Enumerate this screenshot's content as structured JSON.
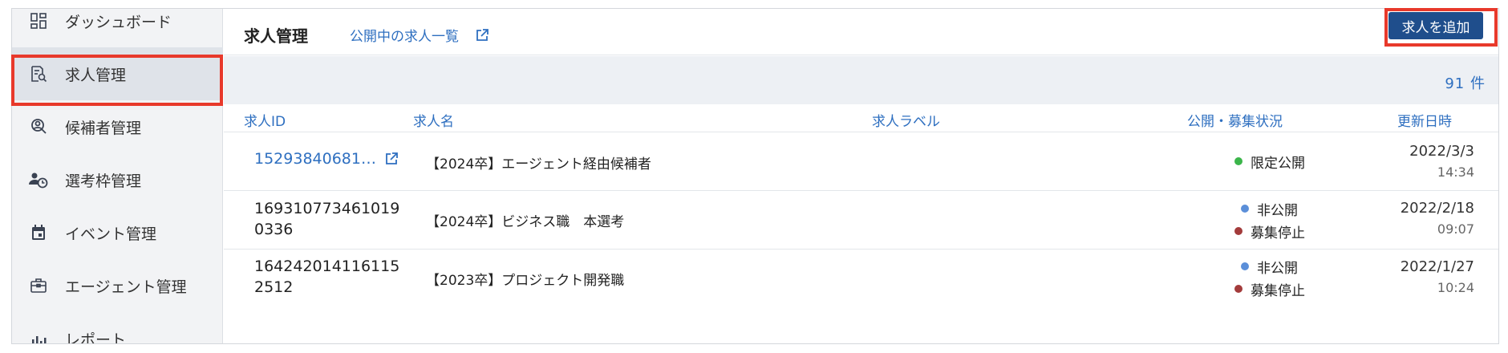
{
  "sidebar": {
    "items": [
      {
        "label": "ダッシュボード",
        "icon": "dashboard-icon"
      },
      {
        "label": "求人管理",
        "icon": "job-search-icon",
        "active": true
      },
      {
        "label": "候補者管理",
        "icon": "candidate-icon"
      },
      {
        "label": "選考枠管理",
        "icon": "schedule-user-icon"
      },
      {
        "label": "イベント管理",
        "icon": "calendar-icon"
      },
      {
        "label": "エージェント管理",
        "icon": "briefcase-icon"
      },
      {
        "label": "レポート",
        "icon": "report-chart-icon"
      }
    ]
  },
  "header": {
    "title": "求人管理",
    "public_link": "公開中の求人一覧",
    "add_button": "求人を追加"
  },
  "count_text": "91 件",
  "table": {
    "columns": [
      "求人ID",
      "求人名",
      "求人ラベル",
      "公開・募集状況",
      "更新日時"
    ],
    "rows": [
      {
        "id_line1": "15293840681…",
        "id_line2": "",
        "name": "【2024卒】エージェント経由候補者",
        "statuses": [
          {
            "text": "限定公開",
            "color": "#3bb54a"
          }
        ],
        "date": "2022/3/3",
        "time": "14:34"
      },
      {
        "id_line1": "169310773461019",
        "id_line2": "0336",
        "name": "【2024卒】ビジネス職　本選考",
        "statuses": [
          {
            "text": "非公開",
            "color": "#5b8fd9"
          },
          {
            "text": "募集停止",
            "color": "#a33b3b"
          }
        ],
        "date": "2022/2/18",
        "time": "09:07"
      },
      {
        "id_line1": "164242014116115",
        "id_line2": "2512",
        "name": "【2023卒】プロジェクト開発職",
        "statuses": [
          {
            "text": "非公開",
            "color": "#5b8fd9"
          },
          {
            "text": "募集停止",
            "color": "#a33b3b"
          }
        ],
        "date": "2022/1/27",
        "time": "10:24"
      }
    ]
  },
  "colors": {
    "accent": "#2e6fc0",
    "button": "#1f4e8c",
    "highlight": "#e8392b"
  }
}
